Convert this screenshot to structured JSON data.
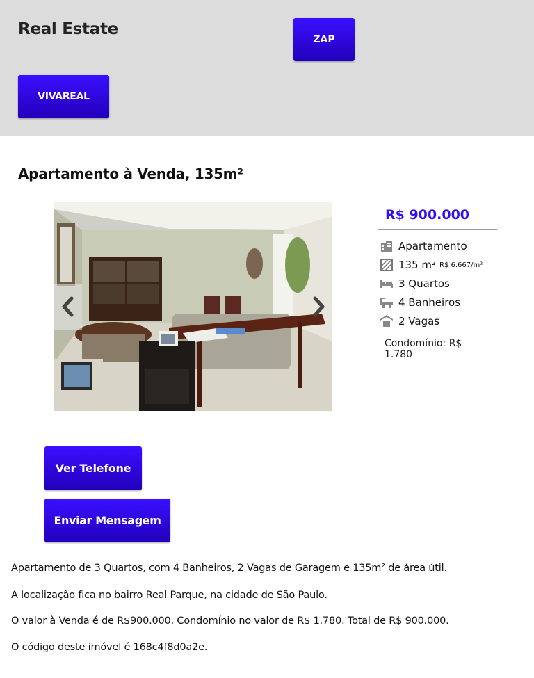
{
  "header": {
    "brand": "Real Estate",
    "zap_label": "ZAP",
    "vivareal_label": "VIVAREAL"
  },
  "listing": {
    "title": "Apartamento à Venda, 135m²",
    "price": "R$ 900.000",
    "features": [
      {
        "icon": "building-icon",
        "label": "Apartamento"
      },
      {
        "icon": "area-icon",
        "label": "135 m²",
        "extra": "R$ 6.667/m²"
      },
      {
        "icon": "bed-icon",
        "label": "3 Quartos"
      },
      {
        "icon": "bathtub-icon",
        "label": "4 Banheiros"
      },
      {
        "icon": "garage-icon",
        "label": "2 Vagas"
      }
    ],
    "condominio": "Condomínio: R$ 1.780"
  },
  "actions": {
    "phone_label": "Ver Telefone",
    "message_label": "Enviar Mensagem"
  },
  "description": [
    "Apartamento de 3 Quartos, com 4 Banheiros, 2 Vagas de Garagem e 135m² de área útil.",
    "A localização fica no bairro Real Parque, na cidade de São Paulo.",
    "O valor à Venda é de R$900.000. Condomínio no valor de R$ 1.780. Total de R$ 900.000.",
    "O código deste imóvel é 168c4f8d0a2e."
  ],
  "colors": {
    "button": "#2a08e0",
    "price": "#3311ee",
    "header_bg": "#dcdcdc"
  }
}
